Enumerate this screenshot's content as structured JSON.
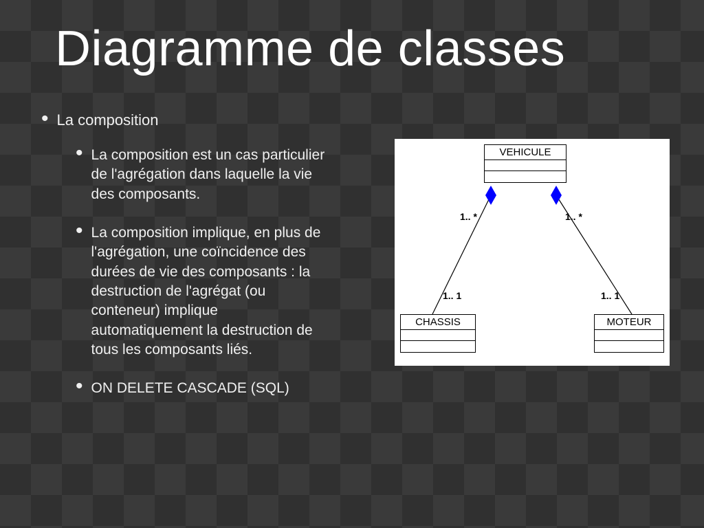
{
  "title": "Diagramme de classes",
  "bullets": {
    "l1": "La composition",
    "l2": [
      "La composition est un cas particulier de l'agrégation dans laquelle la vie des composants.",
      "La composition implique, en plus de l'agrégation, une coïncidence des durées de vie des composants : la destruction de l'agrégat (ou conteneur) implique automatiquement la destruction de tous les composants liés.",
      "ON DELETE CASCADE (SQL)"
    ]
  },
  "diagram": {
    "classes": {
      "vehicule": "VEHICULE",
      "chassis": "CHASSIS",
      "moteur": "MOTEUR"
    },
    "multiplicities": {
      "veh_left": "1.. *",
      "veh_right": "1.. *",
      "chassis": "1.. 1",
      "moteur": "1.. 1"
    }
  }
}
